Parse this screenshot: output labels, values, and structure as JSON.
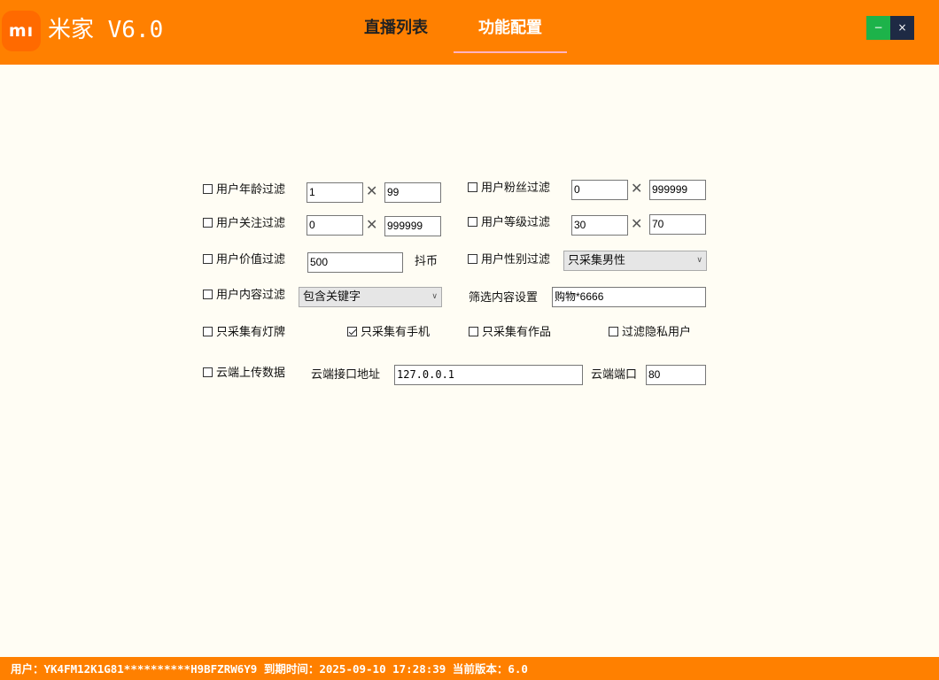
{
  "header": {
    "logo": "mı",
    "title": "米家 V6.0",
    "tabs": [
      {
        "label": "直播列表",
        "active": false
      },
      {
        "label": "功能配置",
        "active": true
      }
    ],
    "minimize_glyph": "−",
    "close_glyph": "×",
    "colors": {
      "bar": "#ff8000",
      "minimize": "#1db34a",
      "close": "#1e2a44"
    }
  },
  "form": {
    "age_filter": {
      "label": "用户年龄过滤",
      "checked": false,
      "min": "1",
      "max": "99"
    },
    "fans_filter": {
      "label": "用户粉丝过滤",
      "checked": false,
      "min": "0",
      "max": "999999"
    },
    "follow_filter": {
      "label": "用户关注过滤",
      "checked": false,
      "min": "0",
      "max": "999999"
    },
    "level_filter": {
      "label": "用户等级过滤",
      "checked": false,
      "min": "30",
      "max": "70"
    },
    "value_filter": {
      "label": "用户价值过滤",
      "checked": false,
      "value": "500",
      "unit": "抖币"
    },
    "gender_filter": {
      "label": "用户性别过滤",
      "checked": false,
      "selected": "只采集男性"
    },
    "content_filter": {
      "label": "用户内容过滤",
      "checked": false,
      "selected": "包含关键字"
    },
    "content_setting": {
      "label": "筛选内容设置",
      "value": "购物*6666"
    },
    "light_badge": {
      "label": "只采集有灯牌",
      "checked": false
    },
    "phone_only": {
      "label": "只采集有手机",
      "checked": true
    },
    "works_only": {
      "label": "只采集有作品",
      "checked": false
    },
    "private_filter": {
      "label": "过滤隐私用户",
      "checked": false
    },
    "cloud_upload": {
      "label": "云端上传数据",
      "checked": false
    },
    "cloud_address": {
      "label": "云端接口地址",
      "value": "127.0.0.1"
    },
    "cloud_port": {
      "label": "云端端口",
      "value": "80"
    },
    "range_separator": "✕"
  },
  "status": {
    "text": "用户：YK4FM12K1G81**********H9BFZRW6Y9 到期时间：2025-09-10 17:28:39 当前版本：6.0"
  }
}
